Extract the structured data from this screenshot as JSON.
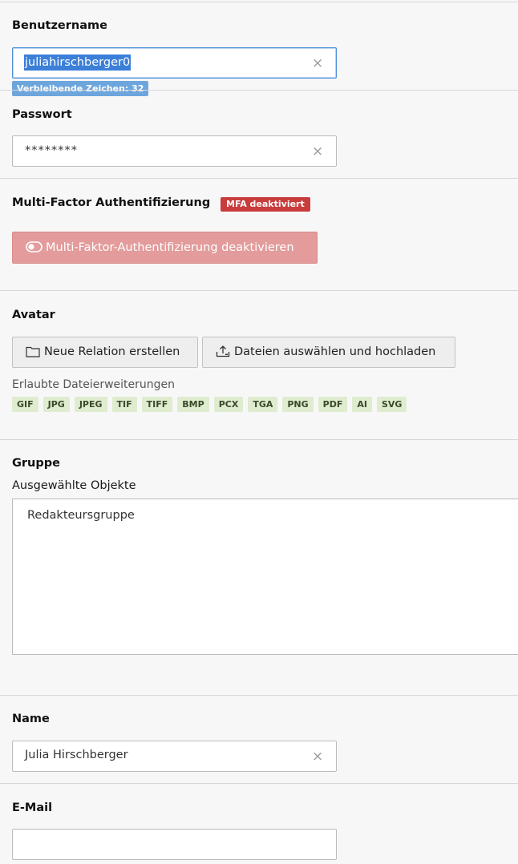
{
  "username": {
    "label": "Benutzername",
    "value": "juliahirschberger0",
    "remaining": "Verbleibende Zeichen: 32"
  },
  "password": {
    "label": "Passwort",
    "value": "********"
  },
  "mfa": {
    "label": "Multi-Factor Authentifizierung",
    "badge": "MFA deaktiviert",
    "button_label": "Multi-Faktor-Authentifizierung deaktivieren"
  },
  "avatar": {
    "label": "Avatar",
    "new_relation_label": "Neue Relation erstellen",
    "upload_label": "Dateien auswählen und hochladen",
    "allowed_label": "Erlaubte Dateierweiterungen",
    "extensions": [
      "GIF",
      "JPG",
      "JPEG",
      "TIF",
      "TIFF",
      "BMP",
      "PCX",
      "TGA",
      "PNG",
      "PDF",
      "AI",
      "SVG"
    ]
  },
  "group": {
    "label": "Gruppe",
    "selected_label": "Ausgewählte Objekte",
    "items": [
      "Redakteursgruppe"
    ]
  },
  "name": {
    "label": "Name",
    "value": "Julia Hirschberger"
  },
  "email": {
    "label": "E-Mail",
    "value": ""
  },
  "icons": {
    "clear": "close-icon",
    "toggle": "toggle-off-icon",
    "folder": "folder-icon",
    "upload": "upload-icon"
  },
  "colors": {
    "focus": "#4c8ed9",
    "selection": "#3b7fd8",
    "info_badge": "#6da6dd",
    "danger_badge": "#c83c3c",
    "danger_button": "#e39b9b",
    "extension_badge": "#dfeccf"
  }
}
